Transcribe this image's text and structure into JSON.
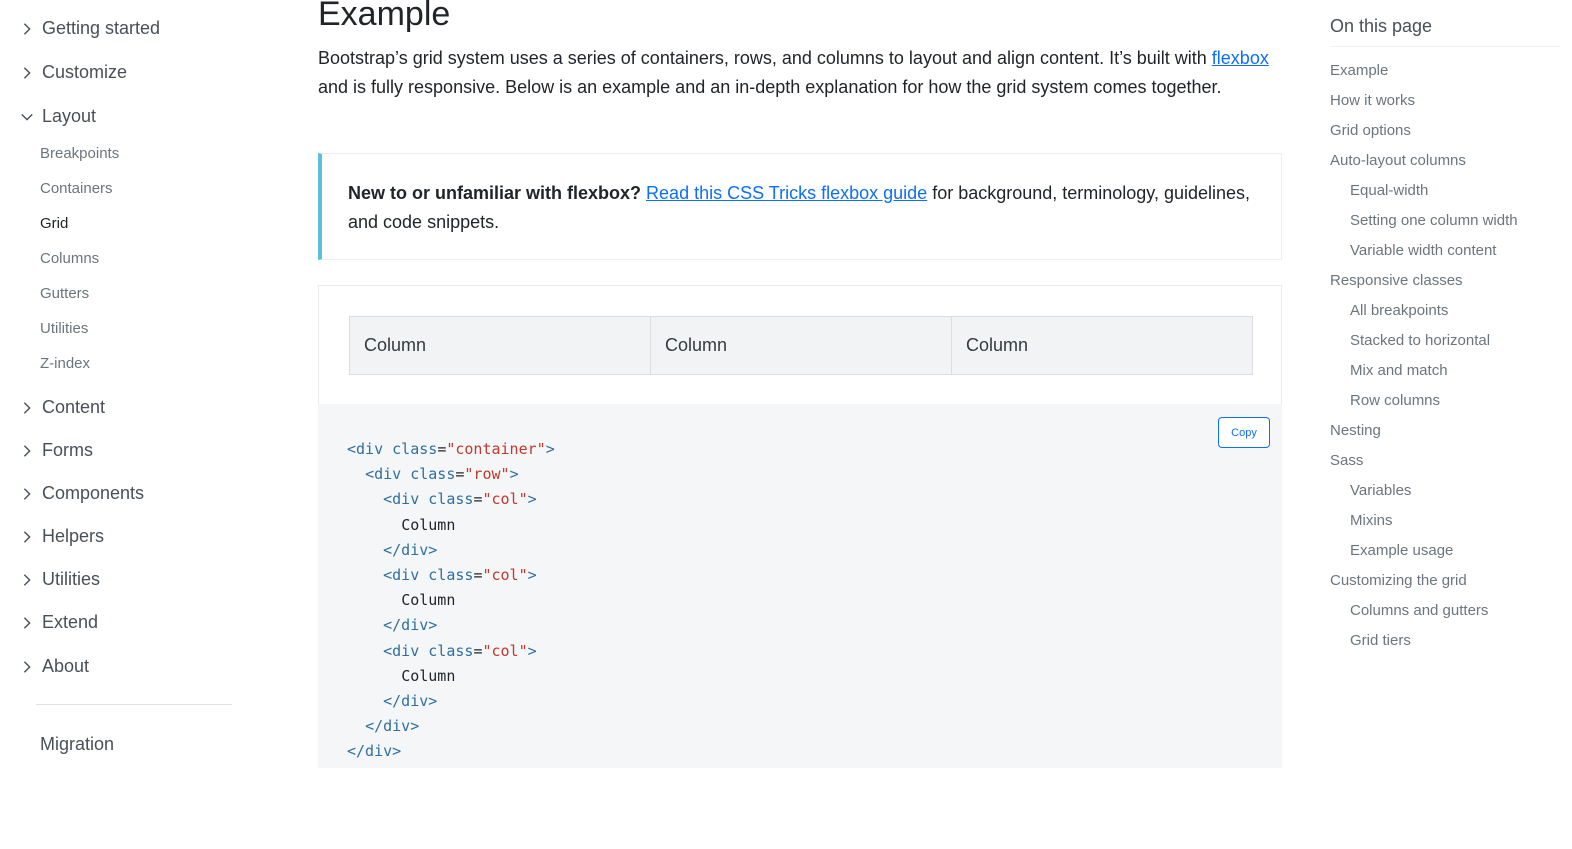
{
  "sidebar": {
    "groups_top": [
      {
        "label": "Getting started",
        "expanded": false
      },
      {
        "label": "Customize",
        "expanded": false
      },
      {
        "label": "Layout",
        "expanded": true
      }
    ],
    "layout_items": [
      "Breakpoints",
      "Containers",
      "Grid",
      "Columns",
      "Gutters",
      "Utilities",
      "Z-index"
    ],
    "active_item": "Grid",
    "groups_bottom": [
      {
        "label": "Content"
      },
      {
        "label": "Forms"
      },
      {
        "label": "Components"
      },
      {
        "label": "Helpers"
      },
      {
        "label": "Utilities"
      },
      {
        "label": "Extend"
      },
      {
        "label": "About"
      }
    ],
    "migration": "Migration"
  },
  "main": {
    "title": "Example",
    "lead_part1": "Bootstrap’s grid system uses a series of containers, rows, and columns to layout and align content. It’s built with ",
    "lead_link": "flexbox",
    "lead_part2": " and is fully responsive. Below is an example and an in-depth explanation for how the grid system comes together.",
    "callout_bold": "New to or unfamiliar with flexbox?",
    "callout_link": "Read this CSS Tricks flexbox guide",
    "callout_rest": " for background, terminology, guidelines, and code snippets.",
    "columns": [
      "Column",
      "Column",
      "Column"
    ],
    "copy_label": "Copy",
    "code": {
      "container_class": "\"container\"",
      "row_class": "\"row\"",
      "col_class": "\"col\"",
      "col_text": "Column"
    }
  },
  "toc": {
    "title": "On this page",
    "items": [
      {
        "label": "Example",
        "level": 1
      },
      {
        "label": "How it works",
        "level": 1
      },
      {
        "label": "Grid options",
        "level": 1
      },
      {
        "label": "Auto-layout columns",
        "level": 1
      },
      {
        "label": "Equal-width",
        "level": 2
      },
      {
        "label": "Setting one column width",
        "level": 2
      },
      {
        "label": "Variable width content",
        "level": 2
      },
      {
        "label": "Responsive classes",
        "level": 1
      },
      {
        "label": "All breakpoints",
        "level": 2
      },
      {
        "label": "Stacked to horizontal",
        "level": 2
      },
      {
        "label": "Mix and match",
        "level": 2
      },
      {
        "label": "Row columns",
        "level": 2
      },
      {
        "label": "Nesting",
        "level": 1
      },
      {
        "label": "Sass",
        "level": 1
      },
      {
        "label": "Variables",
        "level": 2
      },
      {
        "label": "Mixins",
        "level": 2
      },
      {
        "label": "Example usage",
        "level": 2
      },
      {
        "label": "Customizing the grid",
        "level": 1
      },
      {
        "label": "Columns and gutters",
        "level": 2
      },
      {
        "label": "Grid tiers",
        "level": 2
      }
    ]
  },
  "colors": {
    "link": "#0d6efd",
    "callout_border": "#5bc0de",
    "code_bg": "#f5f6f8"
  }
}
